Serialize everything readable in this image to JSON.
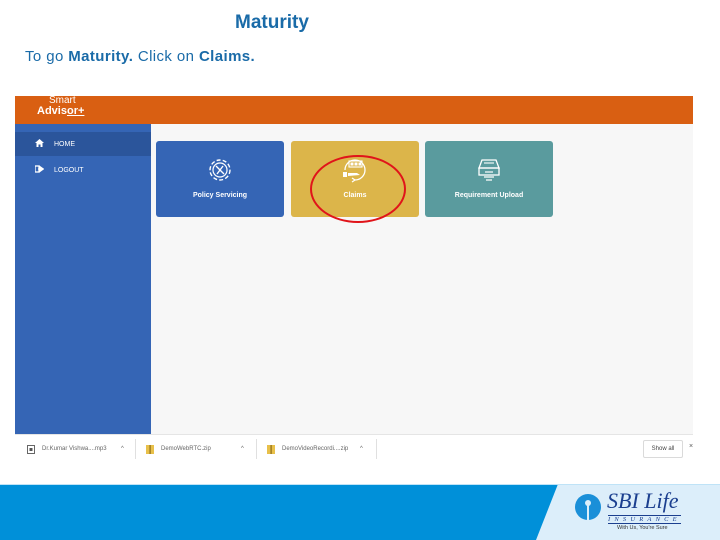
{
  "slide": {
    "title": "Maturity",
    "instruction_prefix": "To go ",
    "instruction_bold_1": "Maturity.",
    "instruction_mid": " Click on ",
    "instruction_bold_2": "Claims."
  },
  "app": {
    "logo_top": "Smart",
    "logo_bottom_a": "Advis",
    "logo_bottom_b": "or+",
    "header_color": "#d95f12",
    "sidebar": {
      "items": [
        {
          "label": "HOME",
          "icon": "home-icon",
          "active": true
        },
        {
          "label": "LOGOUT",
          "icon": "logout-icon",
          "active": false
        }
      ]
    },
    "cards": [
      {
        "label": "Policy Servicing",
        "icon": "gear-wrench-icon",
        "color": "#3565b5"
      },
      {
        "label": "Claims",
        "icon": "claims-hand-icon",
        "color": "#dcb54a"
      },
      {
        "label": "Requirement Upload",
        "icon": "inbox-tray-icon",
        "color": "#5a9b9e"
      }
    ],
    "highlight_color": "#e0141a"
  },
  "downloads": {
    "items": [
      {
        "name": "Dr.Kumar Vishwa....mp3",
        "icon": "audio-file-icon"
      },
      {
        "name": "DemoWebRTC.zip",
        "icon": "zip-file-icon"
      },
      {
        "name": "DemoVideoRecordi....zip",
        "icon": "zip-file-icon"
      }
    ],
    "show_all": "Show all",
    "close": "×"
  },
  "footer": {
    "brand": "SBI Life",
    "subtitle": "INSURANCE",
    "tagline": "With Us, You're Sure",
    "brand_color": "#0090d9"
  }
}
